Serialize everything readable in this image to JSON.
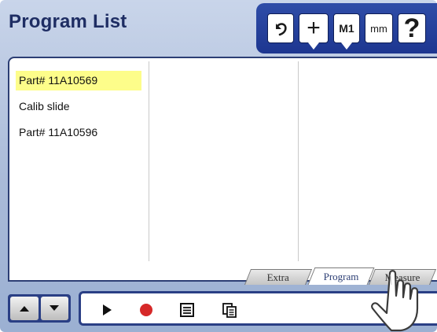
{
  "header": {
    "title": "Program List",
    "toolbar": {
      "undo_icon": "undo-arrow-icon",
      "plus_label": "+",
      "m1_label": "M1",
      "mm_label": "mm",
      "help_label": "?"
    }
  },
  "programs": [
    {
      "name": "Part# 11A10569",
      "selected": true
    },
    {
      "name": "Calib slide",
      "selected": false
    },
    {
      "name": "Part# 11A10596",
      "selected": false
    }
  ],
  "tabs": [
    {
      "label": "Extra",
      "active": false
    },
    {
      "label": "Program",
      "active": true
    },
    {
      "label": "Measure",
      "active": false
    }
  ],
  "bottombar": {
    "nav_icons": [
      "arrow-up-icon",
      "arrow-down-icon"
    ],
    "actions": [
      "play-icon",
      "record-icon",
      "list-icon",
      "copy-icon"
    ]
  },
  "colors": {
    "accent": "#2a3f85",
    "title": "#1e2d63",
    "selection": "#fdfd8a",
    "record": "#d62828"
  }
}
